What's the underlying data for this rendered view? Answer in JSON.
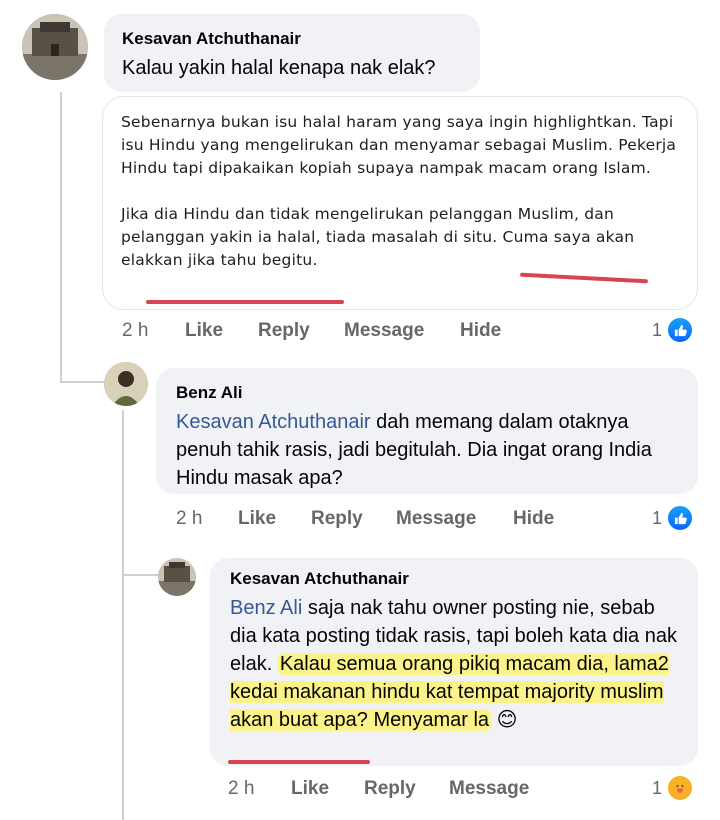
{
  "comment1": {
    "author": "Kesavan Atchuthanair",
    "text": "Kalau yakin halal kenapa nak elak?"
  },
  "quote": {
    "para1": "Sebenarnya bukan isu halal haram yang saya ingin highlightkan. Tapi isu Hindu yang mengelirukan dan menyamar sebagai Muslim. Pekerja Hindu tapi dipakaikan kopiah supaya nampak macam orang Islam.",
    "para2_start": "Jika dia Hindu dan tidak mengelirukan pelanggan Muslim, dan pelanggan yakin ia halal, tiada masalah di situ. ",
    "para2_end": "Cuma saya akan elakkan jika tahu begitu."
  },
  "actions1": {
    "time": "2 h",
    "like": "Like",
    "reply": "Reply",
    "message": "Message",
    "hide": "Hide",
    "count": "1"
  },
  "reply1": {
    "author": "Benz Ali",
    "mention": "Kesavan Atchuthanair",
    "text": " dah memang dalam otaknya penuh tahik rasis, jadi begitulah. Dia ingat orang India Hindu masak apa?"
  },
  "actions2": {
    "time": "2 h",
    "like": "Like",
    "reply": "Reply",
    "message": "Message",
    "hide": "Hide",
    "count": "1"
  },
  "reply2": {
    "author": "Kesavan Atchuthanair",
    "mention": "Benz Ali",
    "text": " saja nak tahu owner posting nie, sebab dia kata posting tidak rasis, tapi boleh kata dia nak elak. ",
    "highlight": "Kalau semua orang pikiq macam dia, lama2 kedai makanan hindu kat tempat majority muslim akan buat apa? Menyamar la",
    "emoji": "😊"
  },
  "actions3": {
    "time": "2 h",
    "like": "Like",
    "reply": "Reply",
    "message": "Message",
    "count": "1"
  },
  "colors": {
    "link": "#385898",
    "highlight": "#fbf38a",
    "underline": "#d94455",
    "meta": "#65676b",
    "bubble": "#f0f2f5"
  },
  "icons": {
    "reaction1": "like-icon",
    "reaction2": "like-icon",
    "reaction3": "care-icon"
  }
}
